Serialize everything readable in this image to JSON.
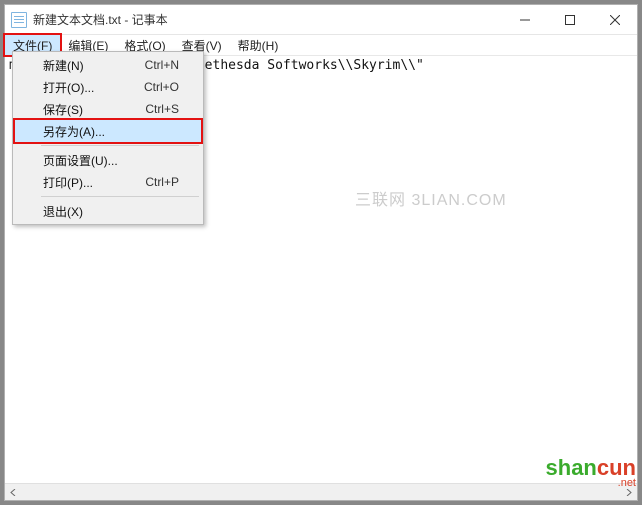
{
  "window": {
    "title": "新建文本文档.txt - 记事本"
  },
  "menubar": {
    "file": "文件(F)",
    "edit": "编辑(E)",
    "format": "格式(O)",
    "view": "查看(V)",
    "help": "帮助(H)"
  },
  "filemenu": {
    "new": {
      "label": "新建(N)",
      "shortcut": "Ctrl+N"
    },
    "open": {
      "label": "打开(O)...",
      "shortcut": "Ctrl+O"
    },
    "save": {
      "label": "保存(S)",
      "shortcut": "Ctrl+S"
    },
    "saveas": {
      "label": "另存为(A)...",
      "shortcut": ""
    },
    "pagesetup": {
      "label": "页面设置(U)...",
      "shortcut": ""
    },
    "print": {
      "label": "打印(P)...",
      "shortcut": "Ctrl+P"
    },
    "exit": {
      "label": "退出(X)",
      "shortcut": ""
    }
  },
  "content": {
    "line1": "m]\"Installed Path\"=\"E:\\\\Bethesda Softworks\\\\Skyrim\\\\\""
  },
  "watermark1": "三联网 3LIAN.COM",
  "watermark2": {
    "a": "shan",
    "b": "cun",
    "c": ".net"
  }
}
